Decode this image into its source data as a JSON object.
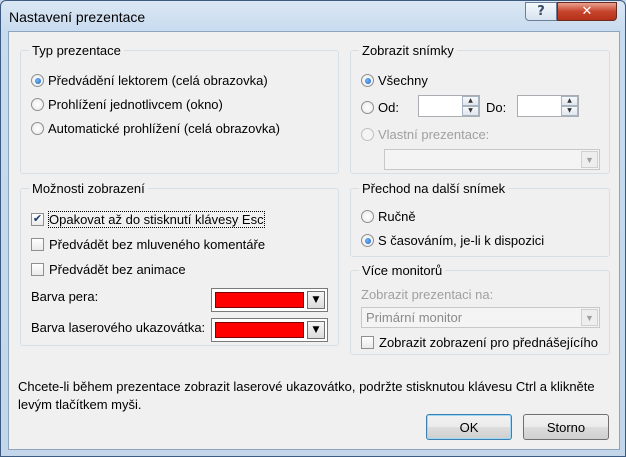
{
  "window": {
    "title": "Nastavení prezentace",
    "help": "?",
    "close": "✕"
  },
  "type_group": {
    "title": "Typ prezentace",
    "options": [
      {
        "label": "Předvádění lektorem (celá obrazovka)",
        "selected": true
      },
      {
        "label": "Prohlížení jednotlivcem (okno)",
        "selected": false
      },
      {
        "label": "Automatické prohlížení (celá obrazovka)",
        "selected": false
      }
    ]
  },
  "slides_group": {
    "title": "Zobrazit snímky",
    "all": "Všechny",
    "from": "Od:",
    "to": "Do:",
    "from_value": "",
    "to_value": "",
    "custom": "Vlastní prezentace:",
    "custom_value": ""
  },
  "display_group": {
    "title": "Možnosti zobrazení",
    "loop": "Opakovat až do stisknutí klávesy Esc",
    "no_narration": "Předvádět bez mluveného komentáře",
    "no_animation": "Předvádět bez animace",
    "pen_color_label": "Barva pera:",
    "laser_color_label": "Barva laserového ukazovátka:",
    "pen_color": "#ff0000",
    "laser_color": "#ff0000"
  },
  "advance_group": {
    "title": "Přechod na další snímek",
    "manual": "Ručně",
    "timing": "S časováním, je-li k dispozici"
  },
  "monitor_group": {
    "title": "Více monitorů",
    "show_on": "Zobrazit prezentaci na:",
    "monitor_value": "Primární monitor",
    "presenter_view": "Zobrazit zobrazení pro přednášejícího"
  },
  "footer_text": "Chcete-li během prezentace zobrazit laserové ukazovátko, podržte stisknutou klávesu Ctrl a klikněte levým tlačítkem myši.",
  "buttons": {
    "ok": "OK",
    "cancel": "Storno"
  },
  "icons": {
    "dropdown": "chevron-down-icon",
    "spin_up": "up-arrow-icon",
    "spin_down": "down-arrow-icon",
    "check": "checkmark-icon"
  }
}
